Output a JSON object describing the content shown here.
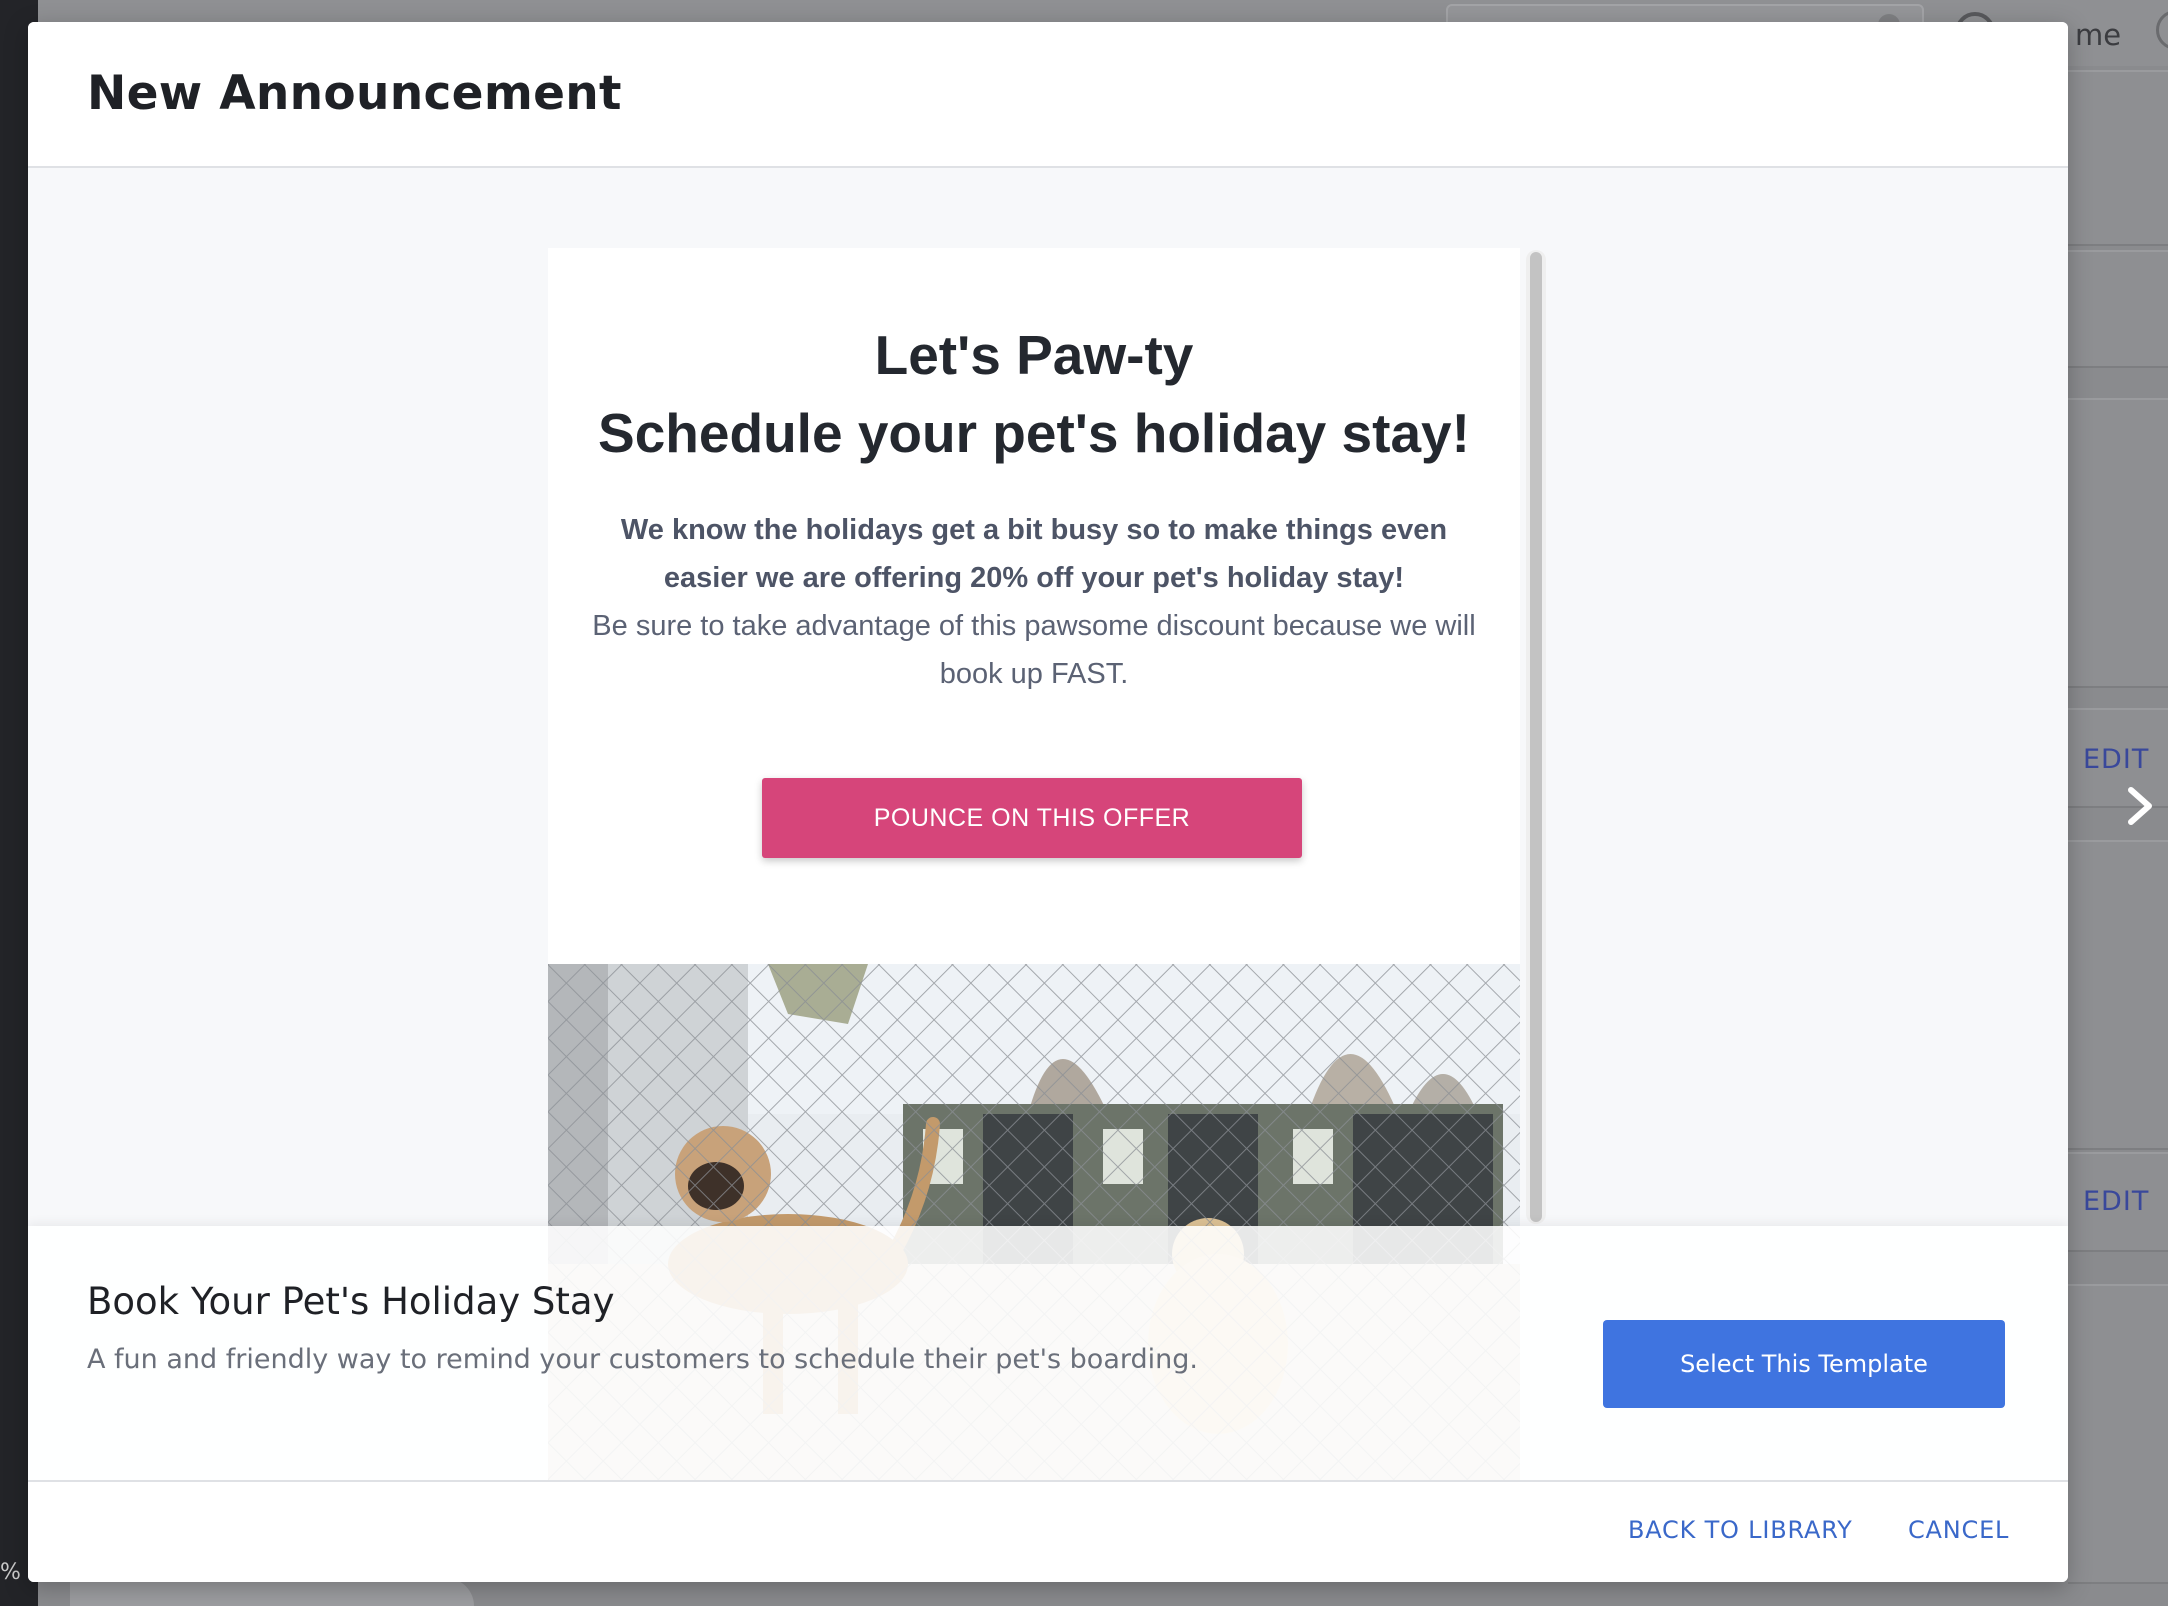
{
  "background": {
    "left_bar_fragment": "%",
    "user_name_fragment": "me",
    "edit_labels": [
      "EDIT",
      "EDIT"
    ]
  },
  "modal": {
    "title": "New Announcement",
    "preview": {
      "headline_line1": "Let's Paw-ty",
      "headline_line2": "Schedule your pet's holiday stay!",
      "body_bold": "We know the holidays get a bit busy so to make things even easier we are offering 20% off your pet's holiday stay!",
      "body_text": "Be sure to take advantage of this pawsome discount because we will book up FAST.",
      "cta_label": "POUNCE ON THIS OFFER",
      "cta_color": "#d6457a"
    },
    "template": {
      "name": "Book Your Pet's Holiday Stay",
      "description": "A fun and friendly way to remind your customers to schedule their pet's boarding.",
      "select_label": "Select This Template"
    },
    "footer": {
      "back_label": "BACK TO LIBRARY",
      "cancel_label": "CANCEL"
    }
  },
  "colors": {
    "primary": "#3f74e0",
    "link": "#3a68c9",
    "accent": "#d6457a"
  }
}
